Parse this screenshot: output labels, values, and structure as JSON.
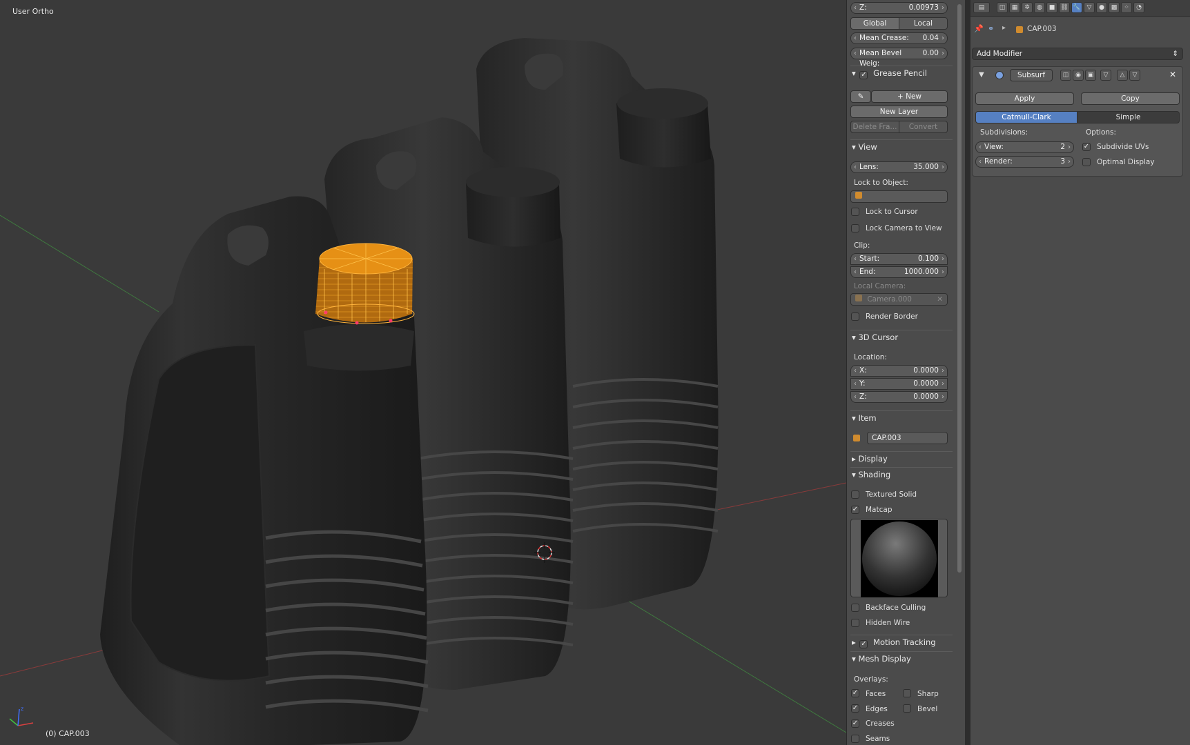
{
  "viewport": {
    "title": "User Ortho",
    "object_info": "(0) CAP.003"
  },
  "npanel": {
    "transform": {
      "z_label": "Z:",
      "z_value": "0.00973",
      "global_label": "Global",
      "local_label": "Local",
      "mean_crease_label": "Mean Crease:",
      "mean_crease_value": "0.04",
      "mean_bevel_label": "Mean Bevel Weig:",
      "mean_bevel_value": "0.00"
    },
    "grease_pencil": {
      "title": "Grease Pencil",
      "new_label": "New",
      "new_layer_label": "New Layer",
      "delete_frame_label": "Delete Fra...",
      "convert_label": "Convert"
    },
    "view": {
      "title": "View",
      "lens_label": "Lens:",
      "lens_value": "35.000",
      "lock_to_object_label": "Lock to Object:",
      "lock_to_cursor_label": "Lock to Cursor",
      "lock_camera_label": "Lock Camera to View",
      "clip_label": "Clip:",
      "start_label": "Start:",
      "start_value": "0.100",
      "end_label": "End:",
      "end_value": "1000.000",
      "local_camera_label": "Local Camera:",
      "local_camera_value": "Camera.000",
      "render_border_label": "Render Border"
    },
    "cursor": {
      "title": "3D Cursor",
      "location_label": "Location:",
      "x_label": "X:",
      "x_value": "0.0000",
      "y_label": "Y:",
      "y_value": "0.0000",
      "z_label": "Z:",
      "z_value": "0.0000"
    },
    "item": {
      "title": "Item",
      "name": "CAP.003"
    },
    "display": {
      "title": "Display"
    },
    "shading": {
      "title": "Shading",
      "textured_solid_label": "Textured Solid",
      "matcap_label": "Matcap",
      "backface_label": "Backface Culling",
      "hidden_wire_label": "Hidden Wire"
    },
    "motion_tracking": {
      "title": "Motion Tracking"
    },
    "mesh_display": {
      "title": "Mesh Display",
      "overlays_label": "Overlays:",
      "faces_label": "Faces",
      "sharp_label": "Sharp",
      "edges_label": "Edges",
      "bevel_label": "Bevel",
      "creases_label": "Creases",
      "seams_label": "Seams"
    }
  },
  "props": {
    "object_name": "CAP.003",
    "add_modifier_label": "Add Modifier",
    "modifier": {
      "name": "Subsurf",
      "apply_label": "Apply",
      "copy_label": "Copy",
      "catmull_label": "Catmull-Clark",
      "simple_label": "Simple",
      "subdivisions_label": "Subdivisions:",
      "options_label": "Options:",
      "view_label": "View:",
      "view_value": "2",
      "render_label": "Render:",
      "render_value": "3",
      "subdivide_uvs_label": "Subdivide UVs",
      "optimal_display_label": "Optimal Display"
    }
  },
  "colors": {
    "accent": "#5680c2",
    "selection": "#f39b1e",
    "panel_bg": "#4b4b4b",
    "viewport_bg": "#3a3a3a"
  }
}
